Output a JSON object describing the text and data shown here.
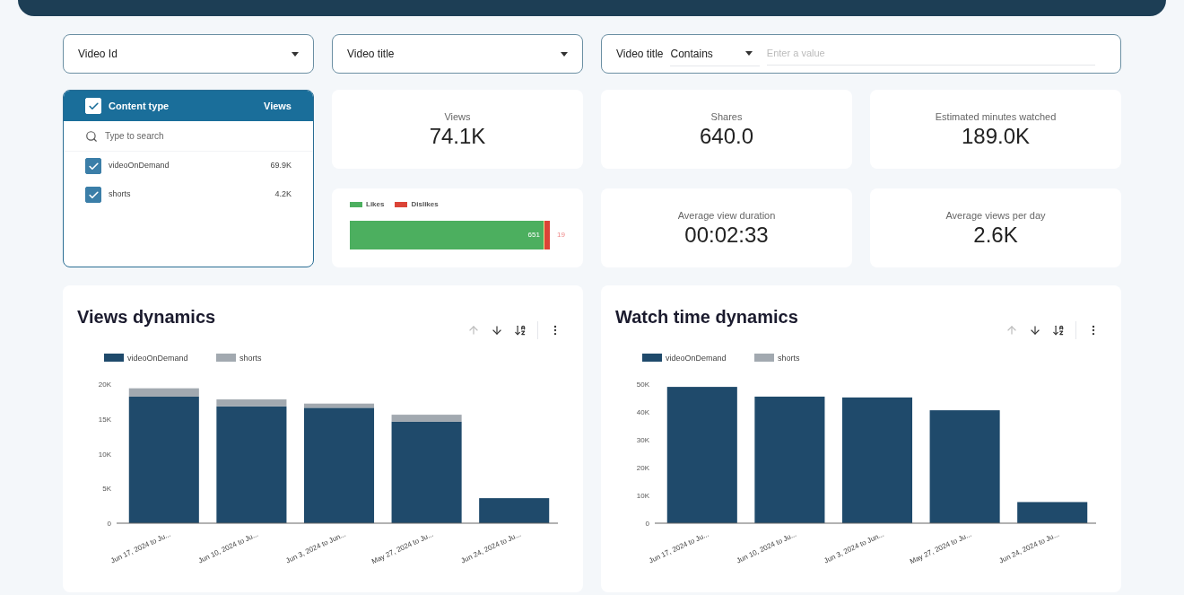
{
  "filters": [
    {
      "kind": "dropdown",
      "label": "Video Id"
    },
    {
      "kind": "dropdown",
      "label": "Video title"
    },
    {
      "kind": "text",
      "label": "Video title",
      "operator": "Contains",
      "placeholder": "Enter a value"
    }
  ],
  "content_type": {
    "title": "Content type",
    "column": "Views",
    "all_checked": true,
    "search_placeholder": "Type to search",
    "items": [
      {
        "label": "videoOnDemand",
        "value": "69.9K",
        "checked": true
      },
      {
        "label": "shorts",
        "value": "4.2K",
        "checked": true
      }
    ]
  },
  "kpis": [
    {
      "label": "Views",
      "value": "74.1K"
    },
    {
      "label": "Shares",
      "value": "640.0"
    },
    {
      "label": "Estimated minutes watched",
      "value": "189.0K"
    },
    {
      "label": "Average view duration",
      "value": "00:02:33"
    },
    {
      "label": "Average views per day",
      "value": "2.6K"
    }
  ],
  "likes_bar": {
    "legend": [
      {
        "label": "Likes",
        "color": "#4caf5f"
      },
      {
        "label": "Dislikes",
        "color": "#db4437"
      }
    ],
    "level": 0.972,
    "likes_label": "651",
    "dislikes_label": "19"
  },
  "charts": [
    {
      "title": "Views dynamics",
      "chart_data": {
        "type": "bar",
        "stacked": true,
        "legend": true,
        "categories": [
          "Jun 17, 2024 to Ju...",
          "Jun 10, 2024 to Ju...",
          "Jun 3, 2024 to Jun...",
          "May 27, 2024 to Ju...",
          "Jun 24, 2024 to Ju..."
        ],
        "ylim": [
          0,
          20000
        ],
        "yticks": [
          {
            "value": 0,
            "label": "0"
          },
          {
            "value": 5000,
            "label": "5K"
          },
          {
            "value": 10000,
            "label": "10K"
          },
          {
            "value": 15000,
            "label": "15K"
          },
          {
            "value": 20000,
            "label": "20K"
          }
        ],
        "series": [
          {
            "name": "videoOnDemand",
            "color": "#1f4a6b",
            "values": [
              18200,
              16800,
              16600,
              14600,
              3600
            ]
          },
          {
            "name": "shorts",
            "color": "#a2a9b0",
            "values": [
              1200,
              1000,
              600,
              1000,
              0
            ]
          }
        ]
      }
    },
    {
      "title": "Watch time dynamics",
      "chart_data": {
        "type": "bar",
        "stacked": true,
        "legend": true,
        "categories": [
          "Jun 17, 2024 to Ju...",
          "Jun 10, 2024 to Ju...",
          "Jun 3, 2024 to Jun...",
          "May 27, 2024 to Ju...",
          "Jun 24, 2024 to Ju..."
        ],
        "ylim": [
          0,
          50000
        ],
        "yticks": [
          {
            "value": 0,
            "label": "0"
          },
          {
            "value": 10000,
            "label": "10K"
          },
          {
            "value": 20000,
            "label": "20K"
          },
          {
            "value": 30000,
            "label": "30K"
          },
          {
            "value": 40000,
            "label": "40K"
          },
          {
            "value": 50000,
            "label": "50K"
          }
        ],
        "series": [
          {
            "name": "videoOnDemand",
            "color": "#1f4a6b",
            "values": [
              49000,
              45500,
              45200,
              40600,
              7600
            ]
          },
          {
            "name": "shorts",
            "color": "#a2a9b0",
            "values": [
              0,
              0,
              0,
              0,
              0
            ]
          }
        ]
      }
    }
  ]
}
